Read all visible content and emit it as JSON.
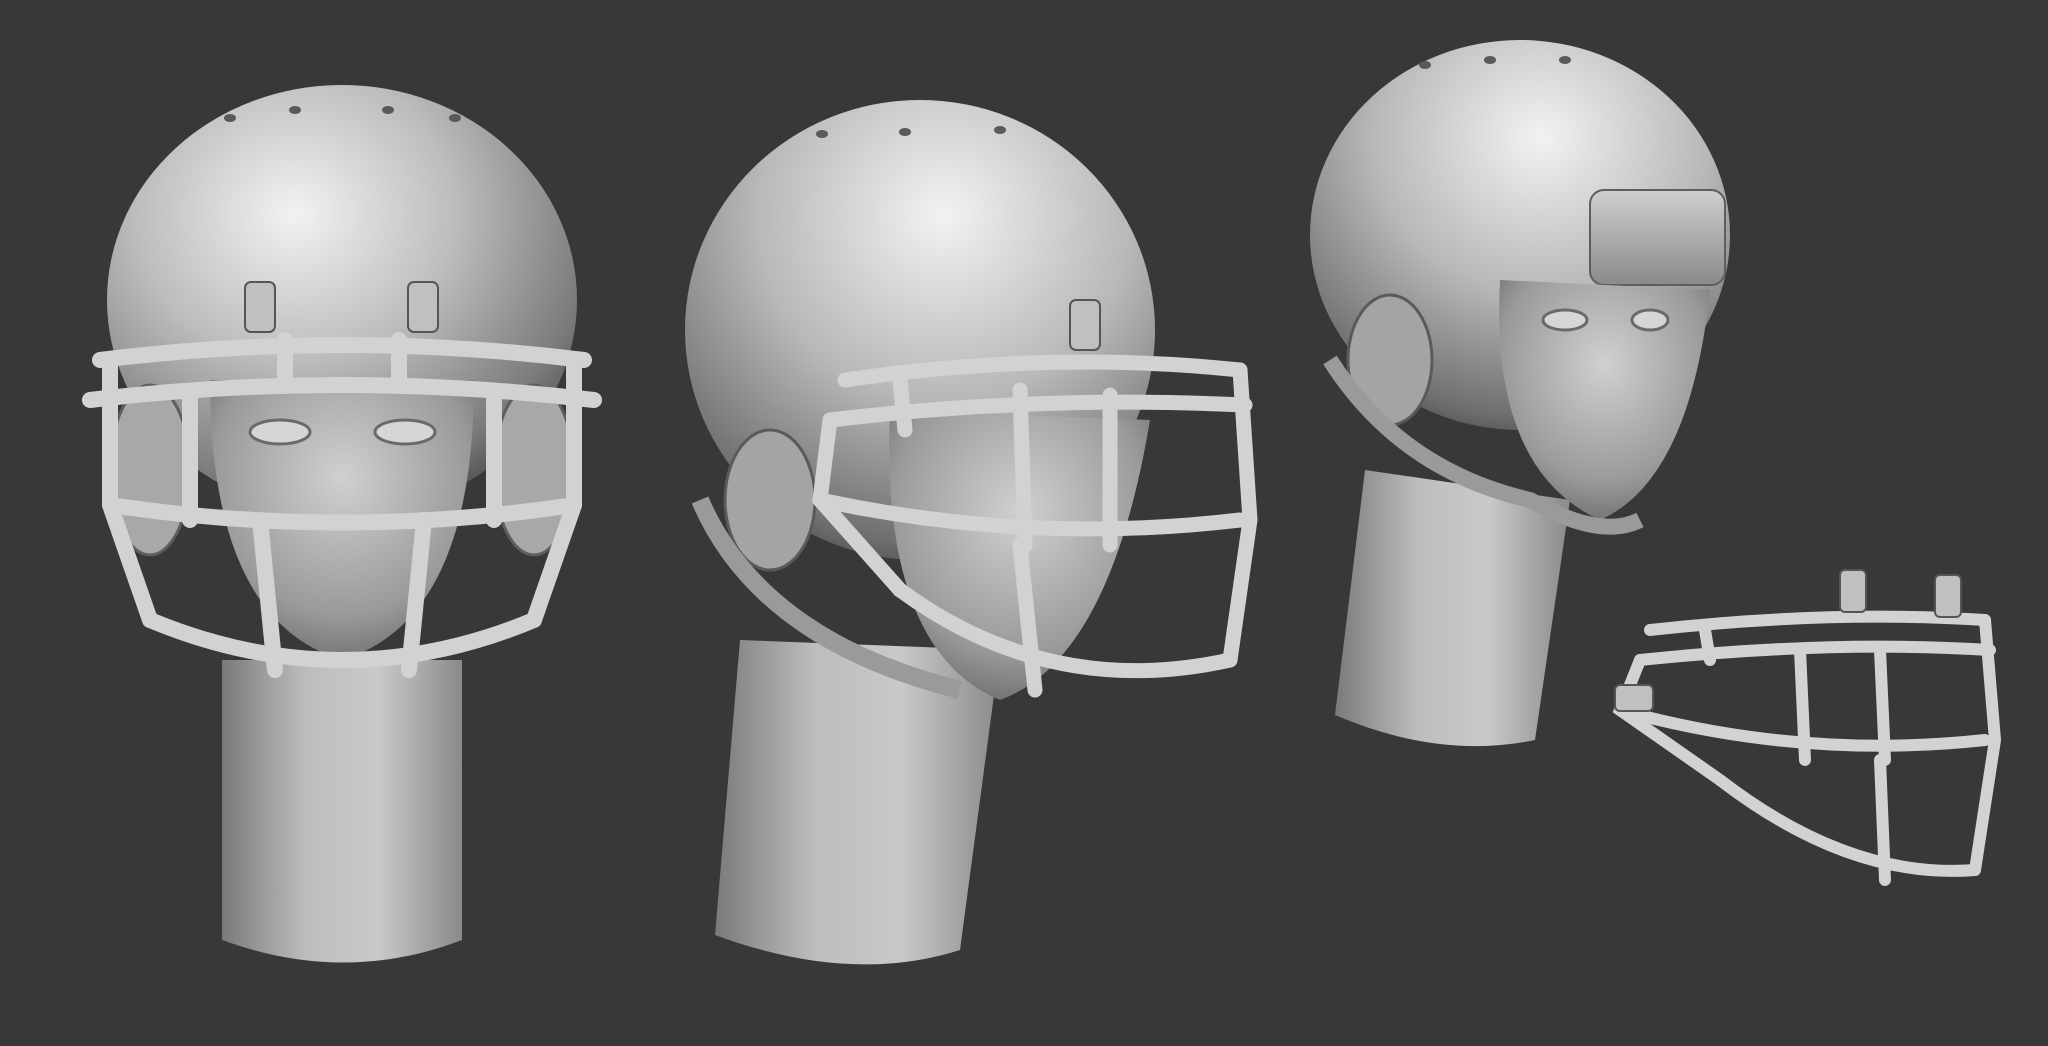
{
  "scene": {
    "background_color": "#383838",
    "material_color": "#b4b4b4",
    "highlight_color": "#f0f0f0",
    "shadow_color": "#4a4a4a",
    "objects": [
      {
        "id": "front-view",
        "kind": "head-with-helmet-and-facemask",
        "view": "front"
      },
      {
        "id": "three-quarter-view",
        "kind": "head-with-helmet-and-facemask",
        "view": "three-quarter"
      },
      {
        "id": "side-view-no-mask",
        "kind": "head-with-helmet",
        "view": "three-quarter-right"
      },
      {
        "id": "facemask-only",
        "kind": "facemask",
        "view": "three-quarter"
      }
    ]
  }
}
